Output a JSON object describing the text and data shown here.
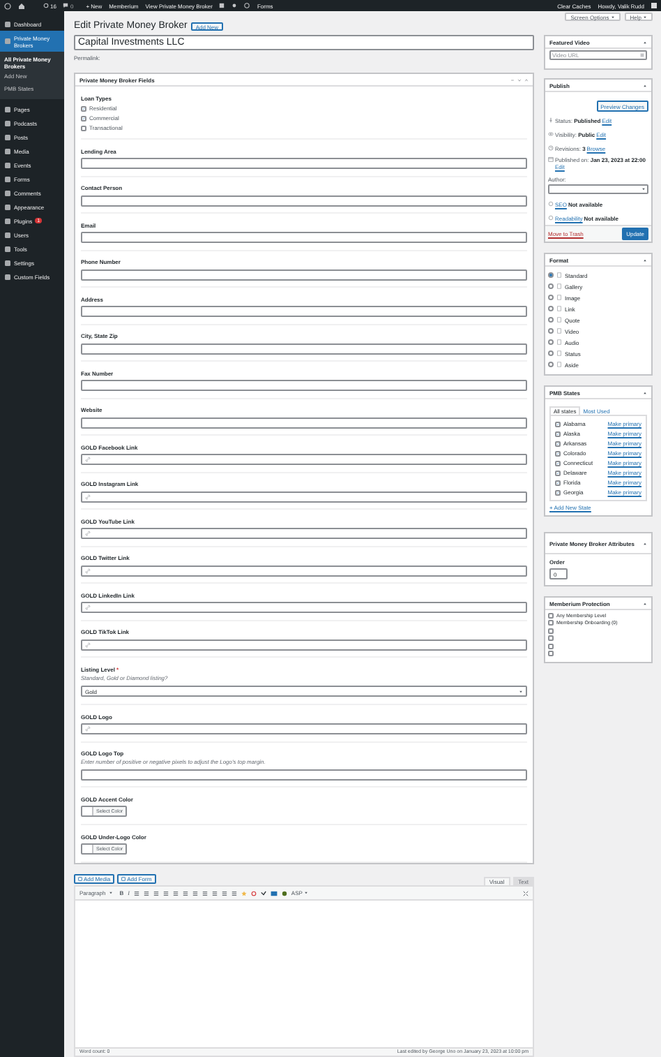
{
  "admin_bar": {
    "updates": "16",
    "comments": "0",
    "new": "+ New",
    "items": [
      "Memberium",
      "View Private Money Broker",
      "Forms"
    ],
    "right": [
      "Clear Caches",
      "Howdy, Valik Rudd"
    ]
  },
  "sidebar": {
    "items": [
      {
        "label": "Dashboard",
        "selected": false
      },
      {
        "label": "Private Money Brokers",
        "selected": true,
        "children": [
          {
            "label": "All Private Money Brokers",
            "selected": true
          },
          {
            "label": "Add New",
            "selected": false
          },
          {
            "label": "PMB States",
            "selected": false
          }
        ]
      },
      {
        "label": "Pages",
        "selected": false
      },
      {
        "label": "Podcasts",
        "selected": false
      },
      {
        "label": "Posts",
        "selected": false
      },
      {
        "label": "Media",
        "selected": false
      },
      {
        "label": "Events",
        "selected": false
      },
      {
        "label": "Forms",
        "selected": false
      },
      {
        "label": "Comments",
        "selected": false
      },
      {
        "label": "Appearance",
        "selected": false
      },
      {
        "label": "Plugins",
        "selected": false,
        "badge": "1"
      },
      {
        "label": "Users",
        "selected": false
      },
      {
        "label": "Tools",
        "selected": false
      },
      {
        "label": "Settings",
        "selected": false
      },
      {
        "label": "Custom Fields",
        "selected": false
      }
    ]
  },
  "header": {
    "title": "Edit Private Money Broker",
    "add_new": "Add New",
    "screen_options": "Screen Options",
    "help": "Help"
  },
  "post_title": "Capital Investments LLC",
  "permalink": "Permalink:",
  "fields_box": {
    "title": "Private Money Broker Fields",
    "fields": [
      {
        "kind": "checkboxes",
        "label": "Loan Types",
        "options": [
          {
            "label": "Residential",
            "checked": true
          },
          {
            "label": "Commercial",
            "checked": true
          },
          {
            "label": "Transactional",
            "checked": false
          }
        ]
      },
      {
        "kind": "text",
        "label": "Lending Area"
      },
      {
        "kind": "text",
        "label": "Contact Person"
      },
      {
        "kind": "text",
        "label": "Email"
      },
      {
        "kind": "text",
        "label": "Phone Number"
      },
      {
        "kind": "text",
        "label": "Address"
      },
      {
        "kind": "text",
        "label": "City, State Zip"
      },
      {
        "kind": "text",
        "label": "Fax Number"
      },
      {
        "kind": "text",
        "label": "Website"
      },
      {
        "kind": "url",
        "label": "GOLD Facebook Link"
      },
      {
        "kind": "url",
        "label": "GOLD Instagram Link"
      },
      {
        "kind": "url",
        "label": "GOLD YouTube Link"
      },
      {
        "kind": "url",
        "label": "GOLD Twitter Link"
      },
      {
        "kind": "url",
        "label": "GOLD LinkedIn Link"
      },
      {
        "kind": "url",
        "label": "GOLD TikTok Link"
      },
      {
        "kind": "select",
        "label": "Listing Level",
        "required_mark": "*",
        "description": "Standard, Gold or Diamond listing?",
        "value": "Gold"
      },
      {
        "kind": "url",
        "label": "GOLD Logo"
      },
      {
        "kind": "text",
        "label": "GOLD Logo Top",
        "description": "Enter number of positive or negative pixels to adjust the Logo's top margin."
      },
      {
        "kind": "color",
        "label": "GOLD Accent Color",
        "button": "Select Color"
      },
      {
        "kind": "color",
        "label": "GOLD Under-Logo Color",
        "button": "Select Color"
      }
    ]
  },
  "editor": {
    "buttons": [
      "Add Media",
      "Add Form"
    ],
    "tabs": [
      {
        "label": "Visual",
        "selected": true
      },
      {
        "label": "Text",
        "selected": false
      }
    ],
    "format": "Paragraph",
    "bold": "B",
    "italic": "I",
    "plugin": "ASP",
    "word_count": "Word count: 0",
    "last_edited": "Last edited by George Uno on January 23, 2023 at 10:00 pm"
  },
  "featured_video": {
    "title": "Featured Video",
    "placeholder": "Video URL"
  },
  "publish": {
    "title": "Publish",
    "preview": "Preview Changes",
    "status_label": "Status:",
    "status": "Published",
    "status_edit": "Edit",
    "visibility_label": "Visibility:",
    "visibility": "Public",
    "visibility_edit": "Edit",
    "revisions_label": "Revisions:",
    "revisions": "3",
    "browse": "Browse",
    "published_label": "Published on:",
    "published": "Jan 23, 2023 at 22:00",
    "published_edit": "Edit",
    "author_label": "Author:",
    "seo": "SEO",
    "seo_status": "Not available",
    "readability": "Readability",
    "readability_status": "Not available",
    "trash": "Move to Trash",
    "update": "Update"
  },
  "format": {
    "title": "Format",
    "options": [
      {
        "label": "Standard",
        "selected": true
      },
      {
        "label": "Gallery",
        "selected": false
      },
      {
        "label": "Image",
        "selected": false
      },
      {
        "label": "Link",
        "selected": false
      },
      {
        "label": "Quote",
        "selected": false
      },
      {
        "label": "Video",
        "selected": false
      },
      {
        "label": "Audio",
        "selected": false
      },
      {
        "label": "Status",
        "selected": false
      },
      {
        "label": "Aside",
        "selected": false
      }
    ]
  },
  "pmb_states": {
    "title": "PMB States",
    "tabs": [
      {
        "label": "All states",
        "selected": true
      },
      {
        "label": "Most Used",
        "selected": false
      }
    ],
    "states": [
      {
        "label": "Alabama",
        "checked": true,
        "action": "Make primary"
      },
      {
        "label": "Alaska",
        "checked": true,
        "action": "Make primary"
      },
      {
        "label": "Arkansas",
        "checked": true,
        "action": "Make primary"
      },
      {
        "label": "Colorado",
        "checked": true,
        "action": "Make primary"
      },
      {
        "label": "Connecticut",
        "checked": true,
        "action": "Make primary"
      },
      {
        "label": "Delaware",
        "checked": true,
        "action": "Make primary"
      },
      {
        "label": "Florida",
        "checked": true,
        "action": "Make primary"
      },
      {
        "label": "Georgia",
        "checked": true,
        "action": "Make primary"
      }
    ],
    "add": "+ Add New State"
  },
  "attributes": {
    "title": "Private Money Broker Attributes",
    "order_label": "Order",
    "order": "0"
  },
  "memberium": {
    "title": "Memberium Protection",
    "options": [
      {
        "label": "Any Membership Level",
        "checked": false
      },
      {
        "label": "Membership Onboarding (0)",
        "checked": false
      },
      {
        "checked": false
      },
      {
        "checked": false
      },
      {
        "checked": false
      },
      {
        "checked": false
      }
    ]
  }
}
